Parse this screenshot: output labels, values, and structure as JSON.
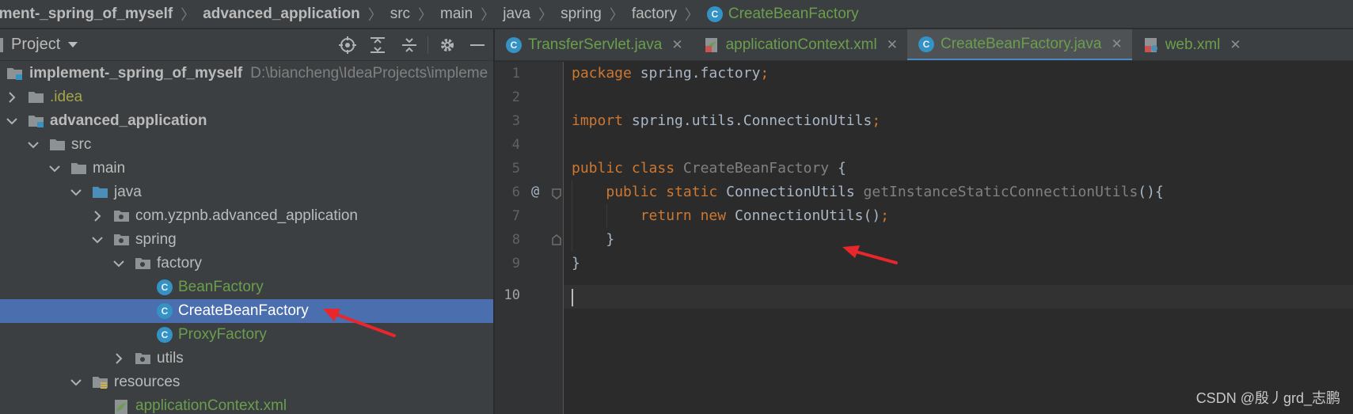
{
  "breadcrumb": {
    "items": [
      "ement-_spring_of_myself",
      "advanced_application",
      "src",
      "main",
      "java",
      "spring",
      "factory"
    ],
    "current_class": "CreateBeanFactory"
  },
  "project_panel": {
    "title": "Project",
    "tree": [
      {
        "label": "implement-_spring_of_myself",
        "path": "D:\\biancheng\\IdeaProjects\\impleme"
      },
      {
        "label": ".idea"
      },
      {
        "label": "advanced_application"
      },
      {
        "label": "src"
      },
      {
        "label": "main"
      },
      {
        "label": "java"
      },
      {
        "label": "com.yzpnb.advanced_application"
      },
      {
        "label": "spring"
      },
      {
        "label": "factory"
      },
      {
        "label": "BeanFactory"
      },
      {
        "label": "CreateBeanFactory"
      },
      {
        "label": "ProxyFactory"
      },
      {
        "label": "utils"
      },
      {
        "label": "resources"
      },
      {
        "label": "applicationContext.xml"
      }
    ],
    "class_icon_letter": "C"
  },
  "tabs": [
    {
      "label": "TransferServlet.java",
      "icon": "java-class-icon",
      "active": false
    },
    {
      "label": "applicationContext.xml",
      "icon": "spring-xml-icon",
      "active": false
    },
    {
      "label": "CreateBeanFactory.java",
      "icon": "java-class-icon",
      "active": true
    },
    {
      "label": "web.xml",
      "icon": "web-xml-icon",
      "active": false
    }
  ],
  "editor": {
    "line_numbers": [
      "1",
      "2",
      "3",
      "4",
      "5",
      "6",
      "7",
      "8",
      "9",
      "10"
    ],
    "code": {
      "l1_kw": "package",
      "l1_rest": " spring.factory",
      "l1_semi": ";",
      "l3_kw": "import",
      "l3_rest": " spring.utils.ConnectionUtils",
      "l3_semi": ";",
      "l5_kw1": "public",
      "l5_kw2": "class",
      "l5_name": "CreateBeanFactory",
      "l5_rest": " {",
      "l6_kw1": "public",
      "l6_kw2": "static",
      "l6_type": "ConnectionUtils",
      "l6_method": "getInstanceStaticConnectionUtils",
      "l6_rest": "(){",
      "l7_kw1": "return",
      "l7_kw2": "new",
      "l7_rest": "ConnectionUtils()",
      "l7_semi": ";",
      "l8": "}",
      "l9": "}"
    },
    "gutter_marker": "@"
  },
  "watermark": "CSDN @殷丿grd_志鹏",
  "colors": {
    "keyword": "#cc7832",
    "class_green": "#6a9e4d",
    "selection": "#4b6eaf",
    "annotation_arrow": "#e8262b"
  }
}
